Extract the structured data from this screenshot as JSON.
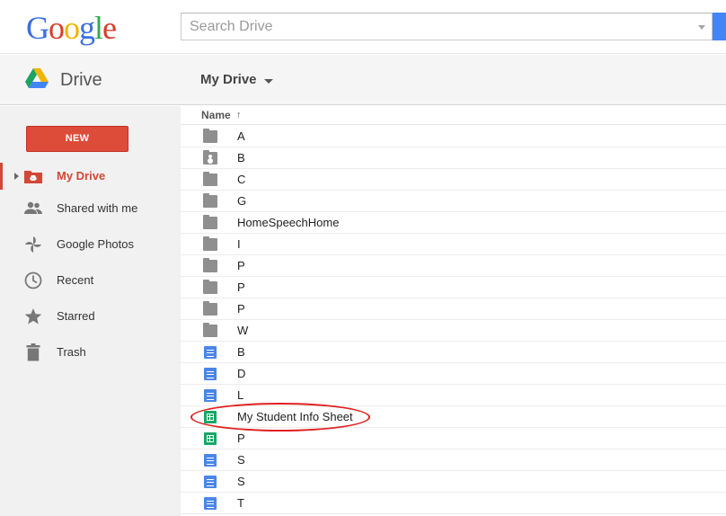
{
  "logo": {
    "letters": [
      "G",
      "o",
      "o",
      "g",
      "l",
      "e"
    ]
  },
  "search": {
    "placeholder": "Search Drive",
    "value": ""
  },
  "header": {
    "app_title": "Drive",
    "location": "My Drive"
  },
  "sidebar": {
    "new_label": "NEW",
    "items": [
      {
        "label": "My Drive",
        "icon": "my-drive-icon",
        "active": true
      },
      {
        "label": "Shared with me",
        "icon": "shared-people-icon",
        "active": false
      },
      {
        "label": "Google Photos",
        "icon": "photos-pinwheel-icon",
        "active": false
      },
      {
        "label": "Recent",
        "icon": "clock-icon",
        "active": false
      },
      {
        "label": "Starred",
        "icon": "star-icon",
        "active": false
      },
      {
        "label": "Trash",
        "icon": "trash-icon",
        "active": false
      }
    ]
  },
  "list": {
    "column_name": "Name",
    "sort_arrow": "↑",
    "rows": [
      {
        "name": "A",
        "type": "folder"
      },
      {
        "name": "B",
        "type": "shared-folder"
      },
      {
        "name": "C",
        "type": "folder"
      },
      {
        "name": "G",
        "type": "folder"
      },
      {
        "name": "HomeSpeechHome",
        "type": "folder"
      },
      {
        "name": "I",
        "type": "folder"
      },
      {
        "name": "P",
        "type": "folder"
      },
      {
        "name": "P",
        "type": "folder"
      },
      {
        "name": "P",
        "type": "folder"
      },
      {
        "name": "W",
        "type": "folder"
      },
      {
        "name": "B",
        "type": "doc"
      },
      {
        "name": "D",
        "type": "doc"
      },
      {
        "name": "L",
        "type": "doc"
      },
      {
        "name": "My Student Info Sheet",
        "type": "sheet"
      },
      {
        "name": "P",
        "type": "sheet"
      },
      {
        "name": "S",
        "type": "doc"
      },
      {
        "name": "S",
        "type": "doc"
      },
      {
        "name": "T",
        "type": "doc"
      }
    ]
  },
  "colors": {
    "accent_red": "#dd4b39",
    "doc_blue": "#4a86e8",
    "sheet_green": "#16a765",
    "annotation_red": "#e02020"
  }
}
